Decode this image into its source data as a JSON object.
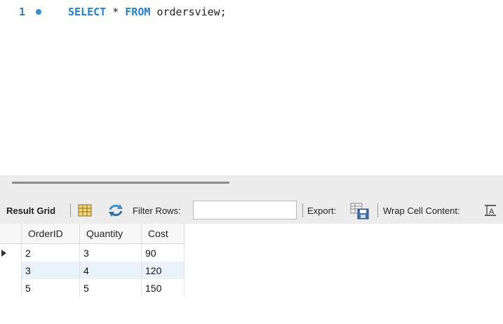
{
  "editor": {
    "line_number": "1",
    "code": {
      "kw1": "SELECT",
      "star": "*",
      "kw2": "FROM",
      "table": "ordersview;"
    }
  },
  "toolbar": {
    "result_grid_label": "Result Grid",
    "filter_rows_label": "Filter Rows:",
    "filter_value": "",
    "export_label": "Export:",
    "wrap_cell_label": "Wrap Cell Content:",
    "grid_icon": "grid-layout-icon",
    "refresh_icon": "refresh-icon",
    "export_icon": "export-icon",
    "wrap_icon": "wrap-text-icon"
  },
  "grid": {
    "columns": [
      "OrderID",
      "Quantity",
      "Cost"
    ],
    "rows": [
      [
        "2",
        "3",
        "90"
      ],
      [
        "3",
        "4",
        "120"
      ],
      [
        "5",
        "5",
        "150"
      ]
    ]
  },
  "colors": {
    "keyword": "#1f7fd8",
    "selected_row": "#e9f2fb",
    "toolbar_bg": "#ececec"
  }
}
